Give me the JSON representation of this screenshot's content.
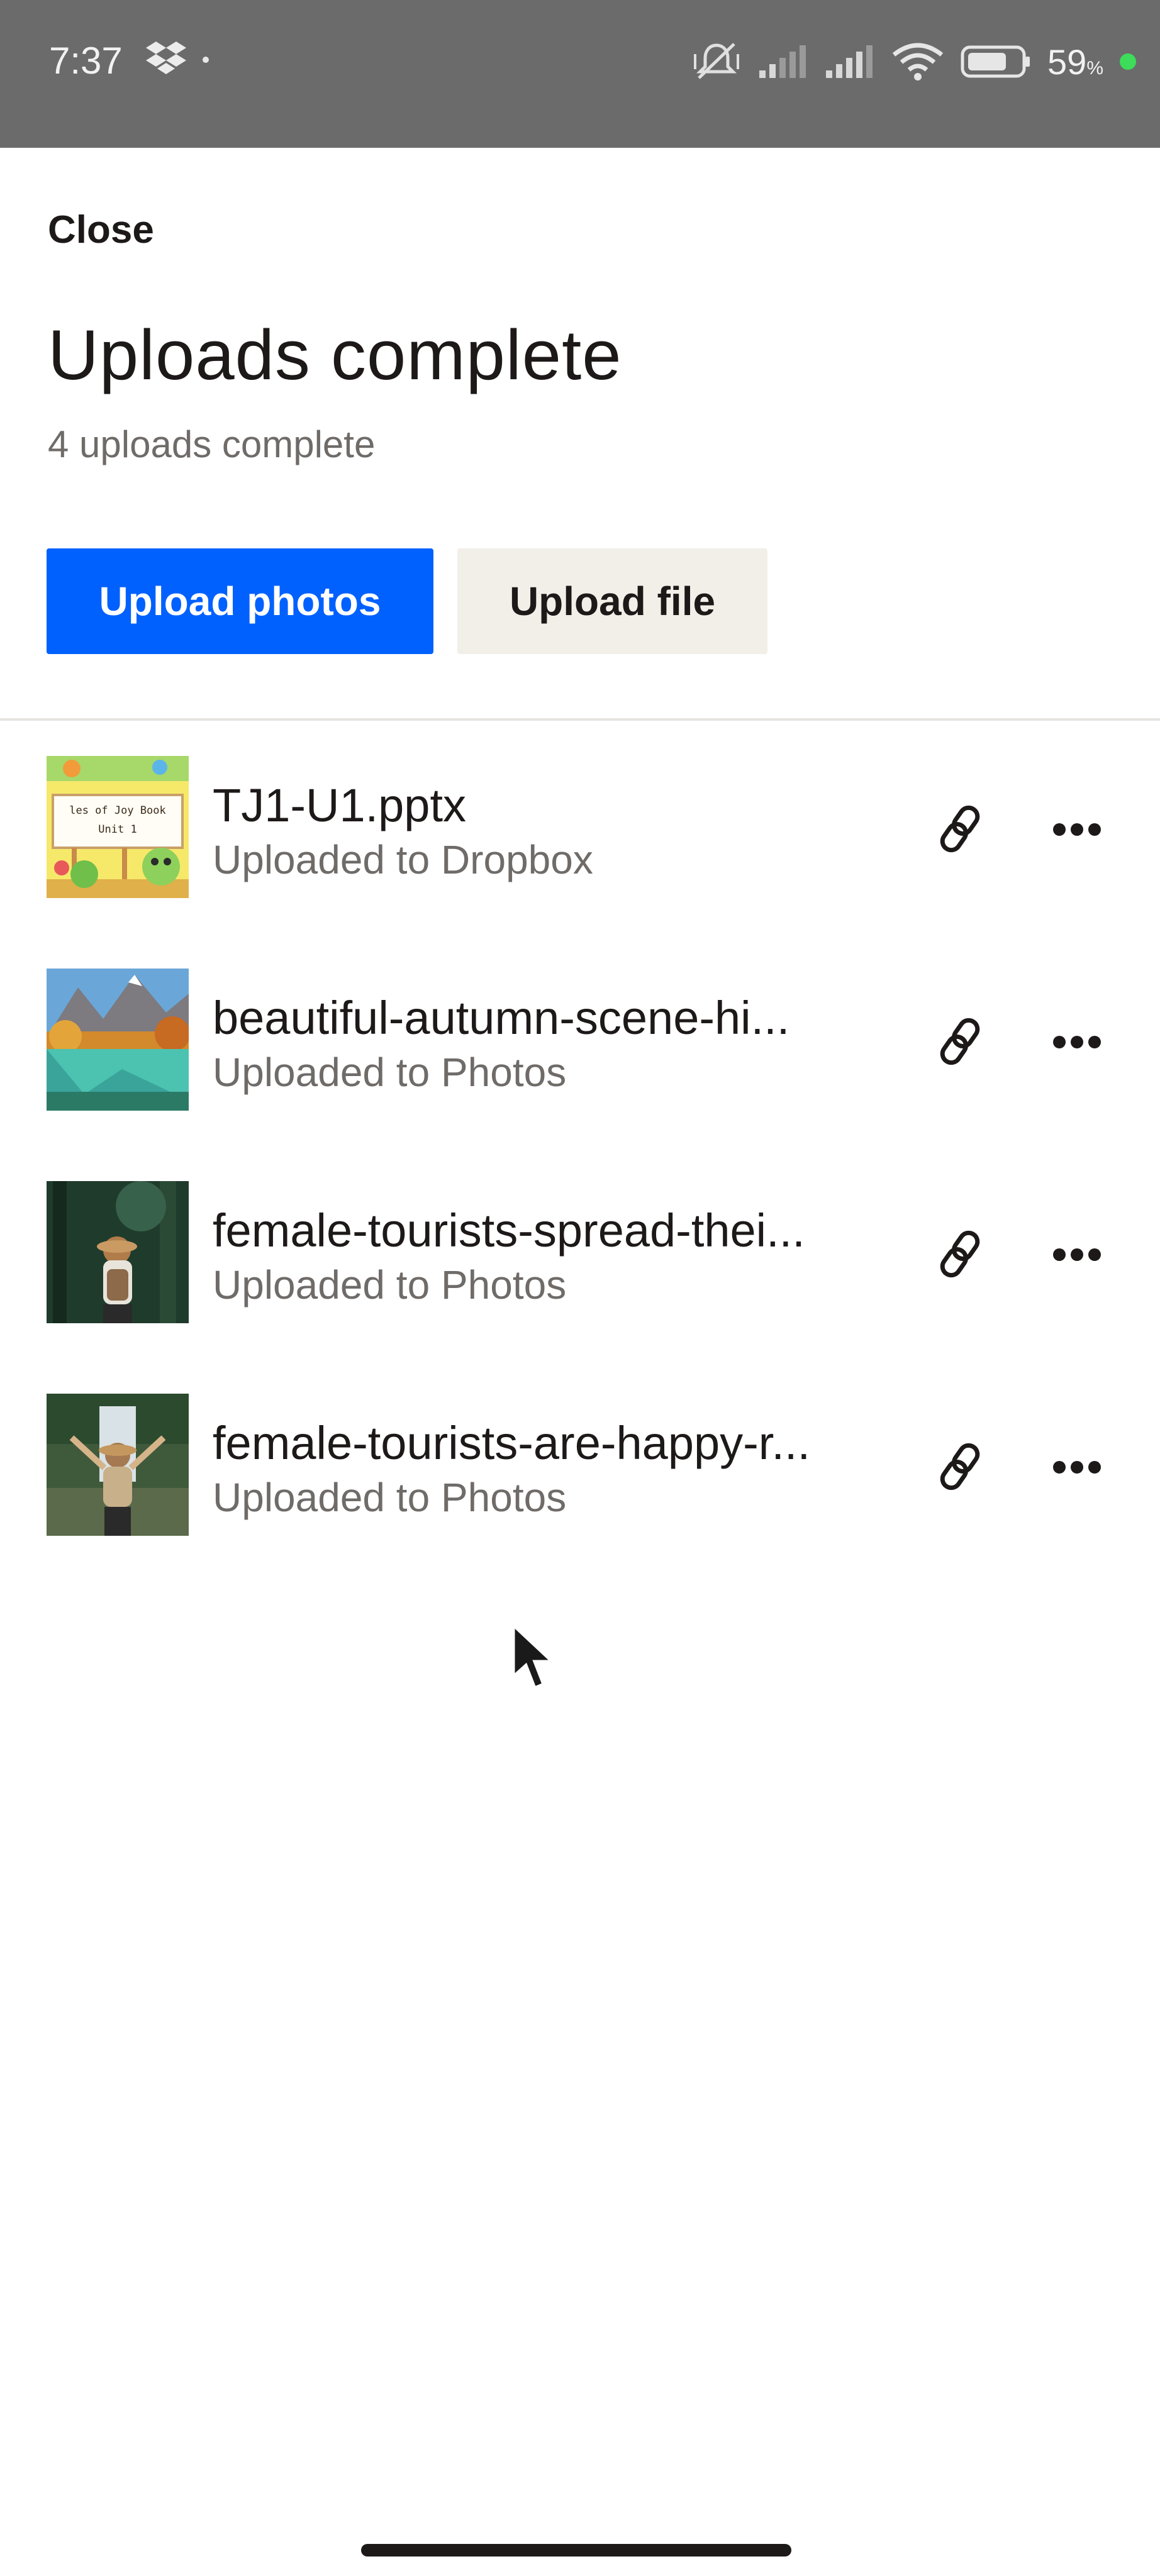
{
  "status_bar": {
    "time": "7:37",
    "battery_percent": "59",
    "battery_unit": "%",
    "icons": [
      "dropbox-icon",
      "mute-icon",
      "signal-icon",
      "signal-icon",
      "wifi-icon",
      "battery-icon"
    ]
  },
  "header": {
    "close_label": "Close",
    "title": "Uploads complete",
    "subtitle": "4 uploads complete"
  },
  "actions": {
    "upload_photos_label": "Upload photos",
    "upload_file_label": "Upload file"
  },
  "uploads": [
    {
      "name": "TJ1-U1.pptx",
      "status": "Uploaded to Dropbox",
      "thumb_text_1": "les of Joy Book",
      "thumb_text_2": "Unit 1"
    },
    {
      "name": "beautiful-autumn-scene-hi...",
      "status": "Uploaded to Photos"
    },
    {
      "name": "female-tourists-spread-thei...",
      "status": "Uploaded to Photos"
    },
    {
      "name": "female-tourists-are-happy-r...",
      "status": "Uploaded to Photos"
    }
  ],
  "colors": {
    "accent": "#0061fe",
    "secondary_button": "#f2efe9",
    "text_primary": "#1e1919",
    "text_secondary": "#6f6b68",
    "status_bar": "#6b6b6b"
  }
}
